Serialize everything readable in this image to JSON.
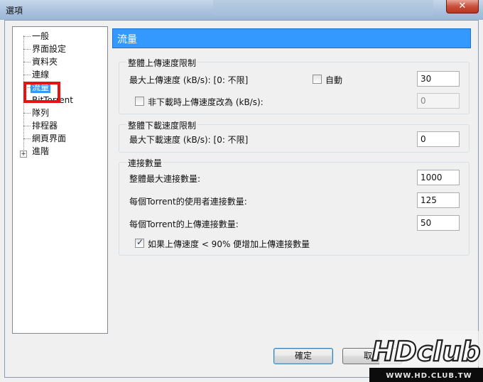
{
  "window": {
    "title": "選項",
    "close_glyph": "✕"
  },
  "background_text": [
    "",
    "",
    ""
  ],
  "tree": {
    "items": [
      {
        "label": "一般"
      },
      {
        "label": "界面設定"
      },
      {
        "label": "資料夾"
      },
      {
        "label": "連線"
      },
      {
        "label": "流量",
        "selected": true
      },
      {
        "label": "BitTorrent"
      },
      {
        "label": "隊列"
      },
      {
        "label": "排程器"
      },
      {
        "label": "網頁界面"
      },
      {
        "label": "進階",
        "expandable": true
      }
    ],
    "expander_glyph": "+"
  },
  "header": {
    "title": "流量"
  },
  "upload_group": {
    "title": "整體上傳速度限制",
    "max_label": "最大上傳速度 (kB/s): [0: 不限]",
    "auto_label": "自動",
    "auto_checked": false,
    "max_value": "30",
    "alt_label": "非下載時上傳速度改為 (kB/s):",
    "alt_checked": false,
    "alt_value": "0"
  },
  "download_group": {
    "title": "整體下載速度限制",
    "max_label": "最大下載速度 (kB/s): [0: 不限]",
    "max_value": "0"
  },
  "connections_group": {
    "title": "連接數量",
    "global_label": "整體最大連接數量:",
    "global_value": "1000",
    "peers_label": "每個Torrent的使用者連接數量:",
    "peers_value": "125",
    "upload_slots_label": "每個Torrent的上傳連接數量:",
    "upload_slots_value": "50",
    "auto_increase_label": "如果上傳速度 < 90% 便增加上傳連接數量",
    "auto_increase_checked": true
  },
  "buttons": {
    "ok": "確定",
    "cancel": "取消"
  },
  "watermark": {
    "logo": "HDclub",
    "url": "WWW.HD.CLUB.TW"
  },
  "colors": {
    "selection": "#3399ff",
    "highlight_box": "#e81212"
  }
}
